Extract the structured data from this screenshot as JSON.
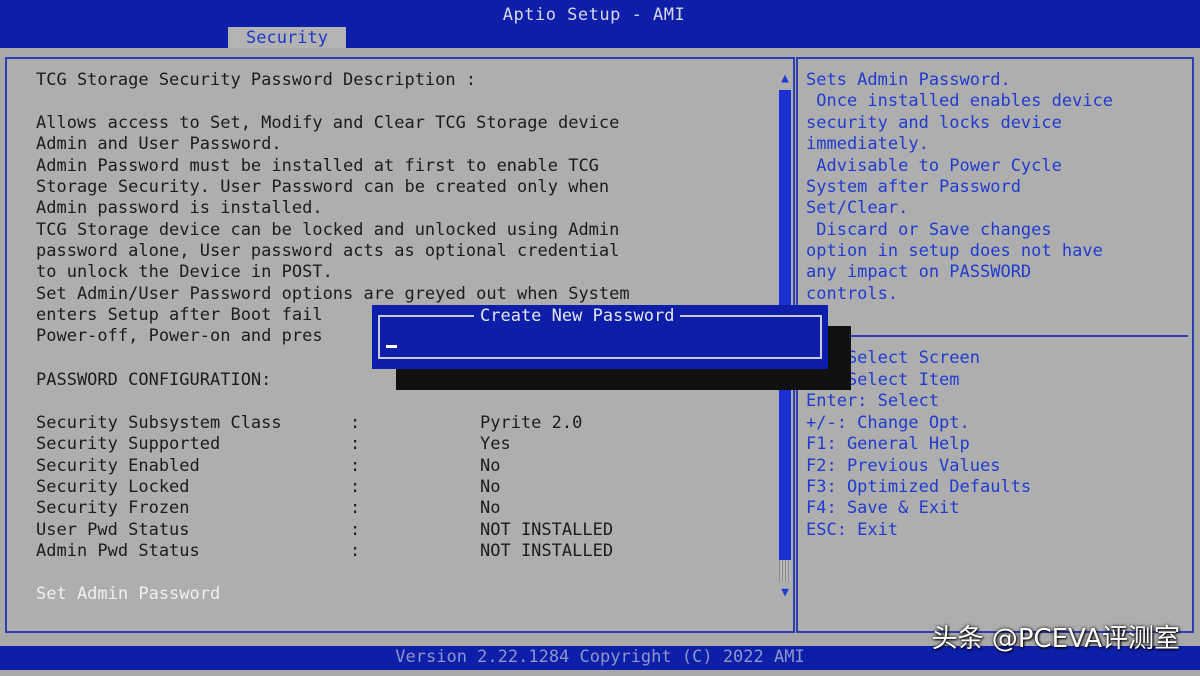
{
  "header": {
    "title": "Aptio Setup - AMI",
    "active_tab": "Security"
  },
  "left_panel": {
    "description_lines": [
      "TCG Storage Security Password Description :",
      "",
      "Allows access to Set, Modify and Clear TCG Storage device",
      "Admin and User Password.",
      "Admin Password must be installed at first to enable TCG",
      "Storage Security. User Password can be created only when",
      "Admin password is installed.",
      "TCG Storage device can be locked and unlocked using Admin",
      "password alone, User password acts as optional credential",
      "to unlock the Device in POST.",
      "Set Admin/User Password options are greyed out when System",
      "enters Setup after Boot fail",
      "Power-off, Power-on and pres"
    ],
    "section_title": "PASSWORD CONFIGURATION:",
    "config_rows": [
      {
        "name": "Security Subsystem Class",
        "sep": ":",
        "value": "Pyrite 2.0"
      },
      {
        "name": "Security Supported",
        "sep": ":",
        "value": "Yes"
      },
      {
        "name": "Security Enabled",
        "sep": ":",
        "value": "No"
      },
      {
        "name": "Security Locked",
        "sep": ":",
        "value": "No"
      },
      {
        "name": "Security Frozen",
        "sep": ":",
        "value": "No"
      },
      {
        "name": "User Pwd Status",
        "sep": ":",
        "value": "NOT INSTALLED"
      },
      {
        "name": "Admin Pwd Status",
        "sep": ":",
        "value": "NOT INSTALLED"
      }
    ],
    "menu_item": "Set Admin Password"
  },
  "right_panel": {
    "help_lines": [
      "Sets Admin Password.",
      " Once installed enables device",
      "security and locks device",
      "immediately.",
      " Advisable to Power Cycle",
      "System after Password",
      "Set/Clear.",
      " Discard or Save changes",
      "option in setup does not have",
      "any impact on PASSWORD",
      "controls."
    ],
    "key_lines": [
      "    Select Screen",
      "    Select Item",
      "Enter: Select",
      "+/-: Change Opt.",
      "F1: General Help",
      "F2: Previous Values",
      "F3: Optimized Defaults",
      "F4: Save & Exit",
      "ESC: Exit"
    ]
  },
  "dialog": {
    "title": "Create New Password",
    "input_value": ""
  },
  "footer": {
    "text": "Version 2.22.1284 Copyright (C) 2022 AMI"
  },
  "watermark": {
    "text": "头条 @PCEVA评测室"
  },
  "colors": {
    "header_blue": "#0d1ea8",
    "panel_gray": "#aeaeae",
    "help_text_blue": "#1f3bd0"
  }
}
